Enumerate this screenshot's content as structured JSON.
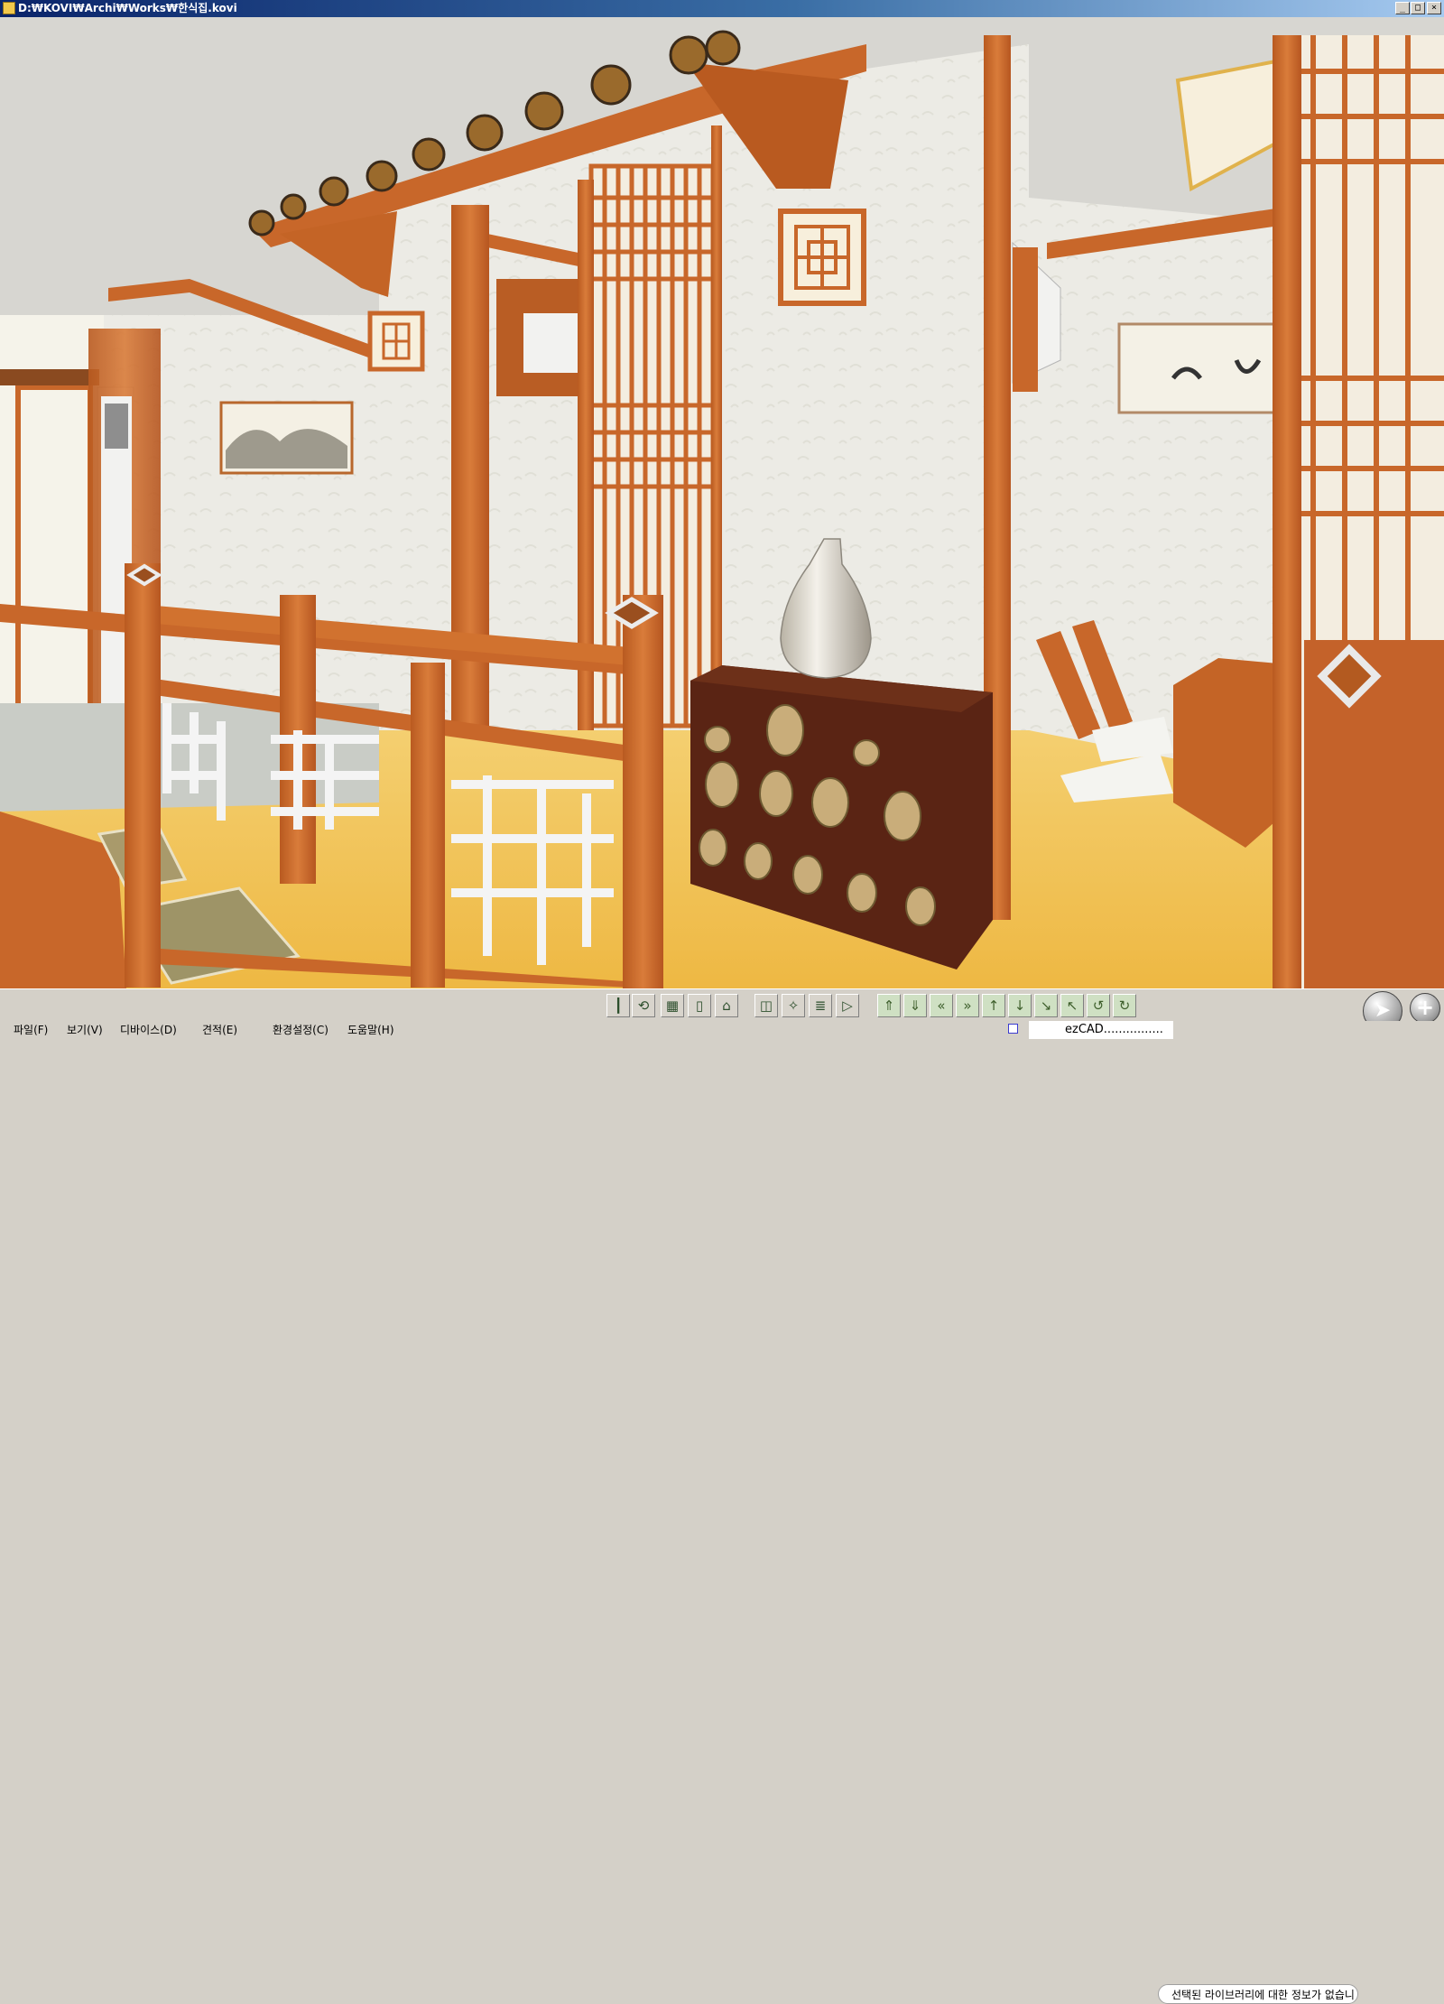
{
  "window": {
    "title": "D:₩KOVI₩Archi₩Works₩한식집.kovi",
    "buttons": {
      "minimize": "_",
      "maximize": "□",
      "close": "×"
    }
  },
  "viewport": {
    "scene": "3d-render",
    "colors": {
      "wood": "#c8672a",
      "wall": "#ecebe5",
      "floor": "#f1c257",
      "ceiling": "#d6d5d0",
      "chest": "#5a2414"
    }
  },
  "toolbar": {
    "tools": [
      {
        "icon": "torch-icon",
        "glyph": "┃"
      },
      {
        "icon": "rotate-object-icon",
        "glyph": "⟲"
      },
      {
        "icon": "grid-icon",
        "glyph": "▦"
      },
      {
        "icon": "page-icon",
        "glyph": "▯"
      },
      {
        "icon": "house-icon",
        "glyph": "⌂"
      },
      {
        "icon": "cube-icon",
        "glyph": "◫"
      },
      {
        "icon": "magic-wand-icon",
        "glyph": "✧"
      },
      {
        "icon": "layers-icon",
        "glyph": "≣"
      },
      {
        "icon": "play-next-icon",
        "glyph": "▷"
      }
    ],
    "navigation": [
      {
        "icon": "move-up-icon",
        "glyph": "⇑"
      },
      {
        "icon": "move-down-icon",
        "glyph": "⇓"
      },
      {
        "icon": "rewind-icon",
        "glyph": "«"
      },
      {
        "icon": "fast-forward-icon",
        "glyph": "»"
      },
      {
        "icon": "arrow-up-icon",
        "glyph": "↑"
      },
      {
        "icon": "arrow-down-icon",
        "glyph": "↓"
      },
      {
        "icon": "arrow-down-right-icon",
        "glyph": "↘"
      },
      {
        "icon": "arrow-up-left-icon",
        "glyph": "↖"
      },
      {
        "icon": "turn-left-icon",
        "glyph": "↺"
      },
      {
        "icon": "turn-right-icon",
        "glyph": "↻"
      }
    ],
    "info_text": "선택된 라이브러리에 대한 정보가 없습니",
    "cursor_button": "➤",
    "add_button": "+"
  },
  "menu": {
    "items": [
      "파일(F)",
      "보기(V)",
      "디바이스(D)",
      "견적(E)",
      "환경설정(C)",
      "도움말(H)"
    ]
  },
  "status": {
    "text": "ezCAD................"
  }
}
